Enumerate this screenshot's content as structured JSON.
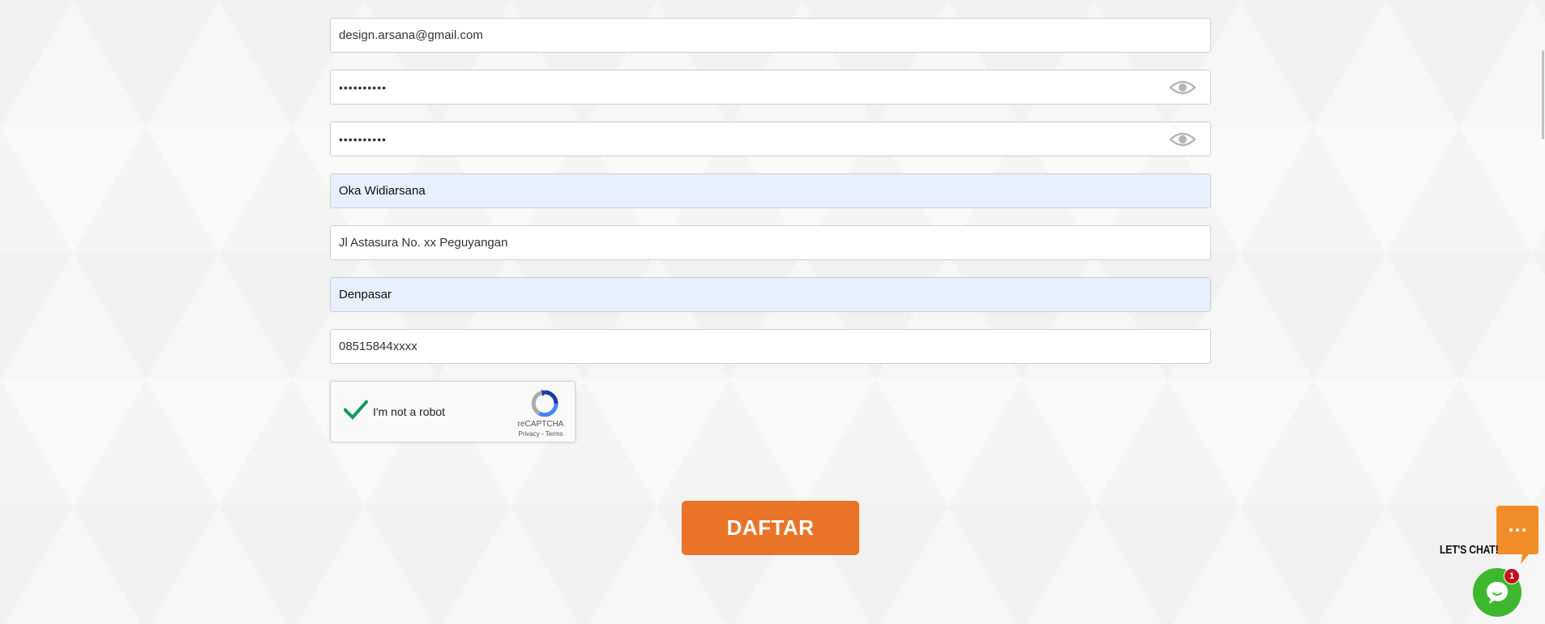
{
  "form": {
    "email": "design.arsana@gmail.com",
    "password": "••••••••••",
    "confirm_password": "••••••••••",
    "full_name": "Oka Widiarsana",
    "address": "Jl Astasura No. xx Peguyangan",
    "city": "Denpasar",
    "phone": "08515844xxxx"
  },
  "captcha": {
    "label": "I'm not a robot",
    "brand": "reCAPTCHA",
    "links": "Privacy - Terms",
    "checked": true
  },
  "submit_label": "DAFTAR",
  "chat": {
    "label": "LET'S CHAT!",
    "badge": "1"
  },
  "colors": {
    "accent": "#e97428",
    "chat_green": "#3db82e",
    "badge_red": "#c0121a",
    "autofill": "#e8f0fe"
  }
}
